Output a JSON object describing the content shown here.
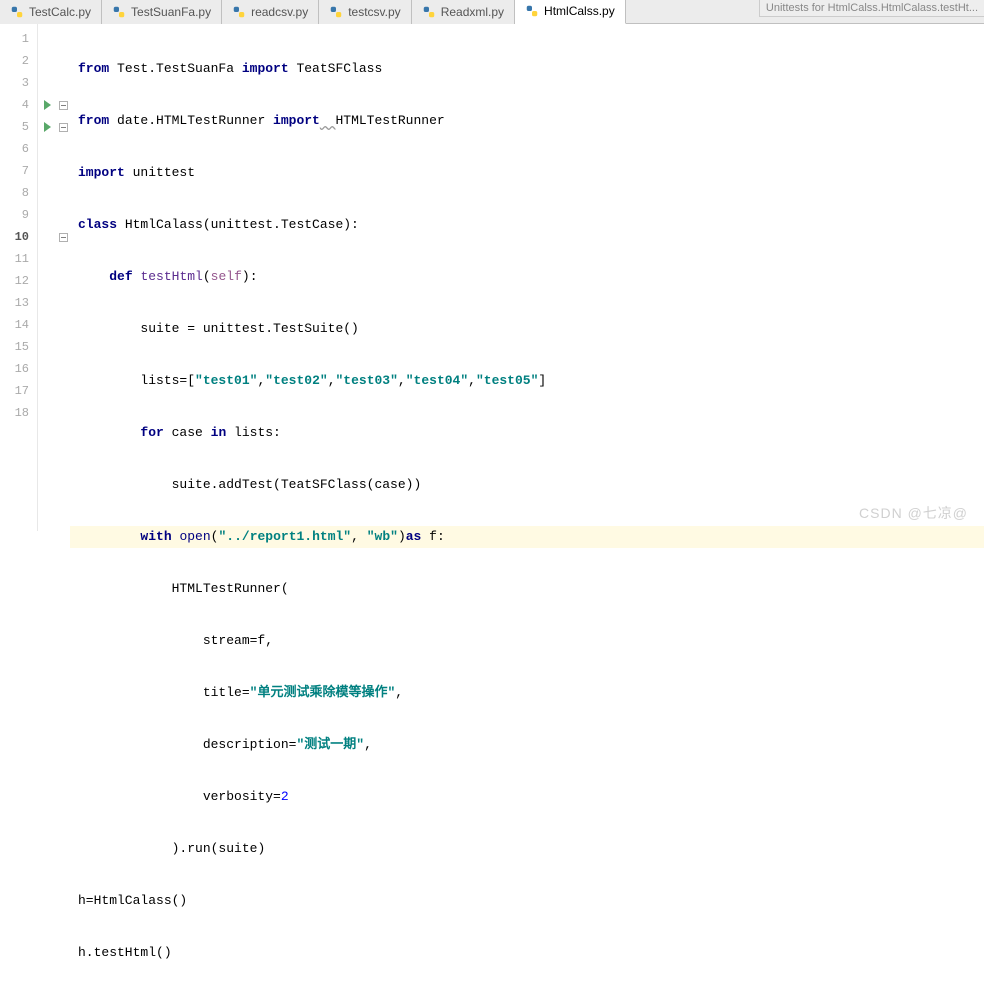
{
  "truncated_title": "Unittests for HtmlCalss.HtmlCalass.testHt...",
  "tabs": [
    {
      "label": "TestCalc.py",
      "active": false
    },
    {
      "label": "TestSuanFa.py",
      "active": false
    },
    {
      "label": "readcsv.py",
      "active": false
    },
    {
      "label": "testcsv.py",
      "active": false
    },
    {
      "label": "Readxml.py",
      "active": false
    },
    {
      "label": "HtmlCalss.py",
      "active": true
    }
  ],
  "code": {
    "l1": {
      "kw1": "from",
      "mod": " Test.TestSuanFa ",
      "kw2": "import",
      "name": " TeatSFClass"
    },
    "l2": {
      "kw1": "from",
      "mod": " date.HTMLTestRunner ",
      "kw2": "import",
      "us": "  ",
      "name": "HTMLTestRunner"
    },
    "l3": {
      "kw1": "import",
      "name": " unittest"
    },
    "l4": {
      "kw1": "class ",
      "name": "HtmlCalass",
      "rest": "(unittest.TestCase):"
    },
    "l5": {
      "indent": "    ",
      "kw1": "def ",
      "name": "testHtml",
      "open": "(",
      "self": "self",
      "close": "):"
    },
    "l6": {
      "indent": "        ",
      "text": "suite = unittest.TestSuite()"
    },
    "l7": {
      "indent": "        ",
      "pre": "lists=[",
      "s1": "\"test01\"",
      "c1": ",",
      "s2": "\"test02\"",
      "c2": ",",
      "s3": "\"test03\"",
      "c3": ",",
      "s4": "\"test04\"",
      "c4": ",",
      "s5": "\"test05\"",
      "post": "]"
    },
    "l8": {
      "indent": "        ",
      "kw1": "for",
      "mid": " case ",
      "kw2": "in",
      "rest": " lists:"
    },
    "l9": {
      "indent": "            ",
      "text": "suite.addTest(TeatSFClass(case))"
    },
    "l10": {
      "indent": "        ",
      "kw1": "with",
      "sp": " ",
      "fn": "open",
      "op": "(",
      "s1": "\"../report1.html\"",
      "c": ", ",
      "s2": "\"wb\"",
      "cp": ")",
      "kw2": "as ",
      "rest": "f:"
    },
    "l11": {
      "indent": "            ",
      "text": "HTMLTestRunner("
    },
    "l12": {
      "indent": "                ",
      "text": "stream=f,"
    },
    "l13": {
      "indent": "                ",
      "pre": "title=",
      "str": "\"单元测试乘除模等操作\"",
      "post": ","
    },
    "l14": {
      "indent": "                ",
      "pre": "description=",
      "str": "\"测试一期\"",
      "post": ","
    },
    "l15": {
      "indent": "                ",
      "pre": "verbosity=",
      "num": "2"
    },
    "l16": {
      "indent": "            ",
      "text": ").run(suite)"
    },
    "l17": {
      "text": "h=HtmlCalass()"
    },
    "l18": {
      "text": "h.testHtml()"
    }
  },
  "line_numbers": [
    "1",
    "2",
    "3",
    "4",
    "5",
    "6",
    "7",
    "8",
    "9",
    "10",
    "11",
    "12",
    "13",
    "14",
    "15",
    "16",
    "17",
    "18"
  ],
  "watermark": "CSDN @七凉@"
}
